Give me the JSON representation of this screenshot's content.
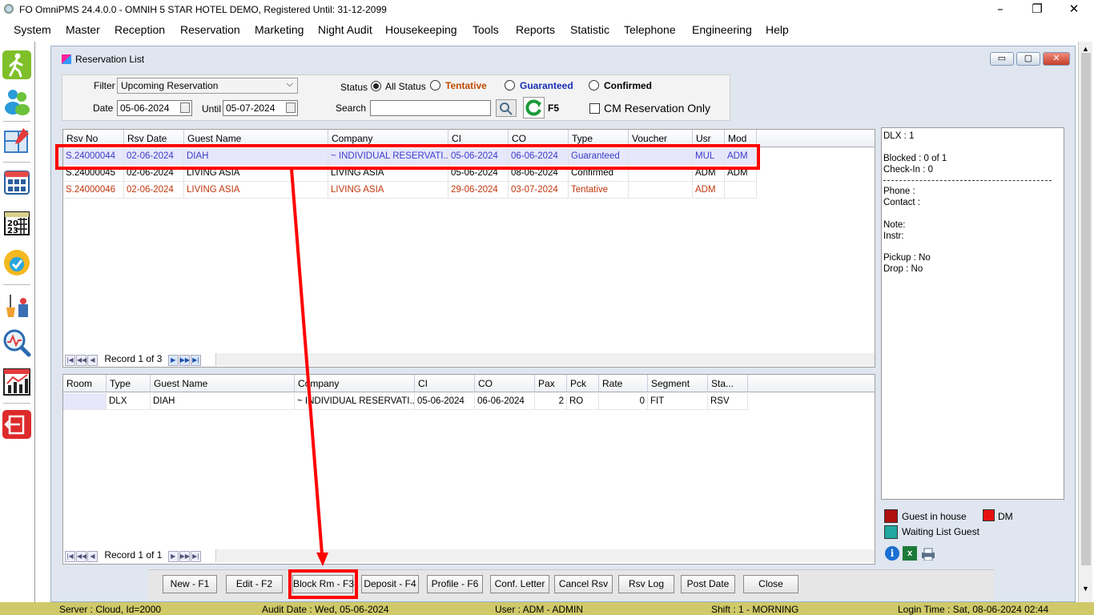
{
  "app": {
    "title": "FO OmniPMS 24.4.0.0 - OMNIH 5 STAR HOTEL DEMO, Registered Until: 31-12-2099",
    "minimize": "–",
    "restore": "❐",
    "close": "✕"
  },
  "menu": [
    "System",
    "Master",
    "Reception",
    "Reservation",
    "Marketing",
    "Night Audit",
    "Housekeeping",
    "Tools",
    "Reports",
    "Statistic",
    "Telephone",
    "Engineering",
    "Help"
  ],
  "sidebar_icons": [
    "walk-in-icon",
    "guests-icon",
    "room-plan-icon",
    "calendar-grid-icon",
    "calendar-2023-icon",
    "availability-icon",
    "housekeeping-icon",
    "search-analysis-icon",
    "statistics-chart-icon",
    "exit-icon"
  ],
  "window": {
    "title": "Reservation List",
    "ctl_min": "▭",
    "ctl_max": "▢",
    "ctl_close": "✕"
  },
  "filter": {
    "filter_label": "Filter",
    "filter_value": "Upcoming Reservation",
    "date_label": "Date",
    "date_value": "05-06-2024",
    "until_label": "Until",
    "until_value": "05-07-2024",
    "status_label": "Status",
    "status_options": [
      "All Status",
      "Tentative",
      "Guaranteed",
      "Confirmed"
    ],
    "status_selected": "All Status",
    "search_label": "Search",
    "search_value": "",
    "refresh_key": "F5",
    "cm_only_label": "CM Reservation Only"
  },
  "reservations": {
    "columns": [
      "Rsv No",
      "Rsv Date",
      "Guest Name",
      "Company",
      "CI",
      "CO",
      "Type",
      "Voucher",
      "Usr",
      "Mod"
    ],
    "rows": [
      [
        "S.24000044",
        "02-06-2024",
        "DIAH",
        "~ INDIVIDUAL RESERVATI...",
        "05-06-2024",
        "06-06-2024",
        "Guaranteed",
        "",
        "MUL",
        "ADM"
      ],
      [
        "S.24000045",
        "02-06-2024",
        "LIVING ASIA",
        "LIVING ASIA",
        "05-06-2024",
        "08-06-2024",
        "Confirmed",
        "",
        "ADM",
        "ADM"
      ],
      [
        "S.24000046",
        "02-06-2024",
        "LIVING ASIA",
        "LIVING ASIA",
        "29-06-2024",
        "03-07-2024",
        "Tentative",
        "",
        "ADM",
        ""
      ]
    ],
    "record_text": "Record 1 of 3"
  },
  "rooms": {
    "columns": [
      "Room",
      "Type",
      "Guest Name",
      "Company",
      "CI",
      "CO",
      "Pax",
      "Pck",
      "Rate",
      "Segment",
      "Sta..."
    ],
    "rows": [
      [
        "",
        "DLX",
        "DIAH",
        "~ INDIVIDUAL RESERVATI...",
        "05-06-2024",
        "06-06-2024",
        "2",
        "RO",
        "0",
        "FIT",
        "RSV"
      ]
    ],
    "record_text": "Record 1 of 1"
  },
  "info": {
    "room_type": "DLX : 1",
    "blocked": "Blocked : 0 of 1",
    "checkin": "Check-In : 0",
    "phone": "Phone :",
    "contact": "Contact :",
    "note": "Note:",
    "instr": "Instr:",
    "pickup": "Pickup : No",
    "drop": "Drop : No"
  },
  "legend": {
    "in_house": "Guest in house",
    "dm": "DM",
    "waiting": "Waiting List Guest",
    "colors": {
      "in_house": "#b01010",
      "dm": "#e81010",
      "waiting": "#20a8a0"
    }
  },
  "buttons": [
    "New - F1",
    "Edit - F2",
    "Block Rm - F3",
    "Deposit - F4",
    "Profile  - F6",
    "Conf. Letter",
    "Cancel Rsv",
    "Rsv Log",
    "Post Date",
    "Close"
  ],
  "status": {
    "server": "Server : Cloud, Id=2000",
    "audit": "Audit Date : Wed, 05-06-2024",
    "user": "User : ADM - ADMIN",
    "shift": "Shift : 1 - MORNING",
    "login": "Login Time : Sat, 08-06-2024 02:44"
  },
  "colors": {
    "status_bar": "#cfc96a",
    "highlight": "#ff0000",
    "selected_row_text": "#3c3cc8",
    "tentative_row_text": "#c0360c",
    "tentative_label": "#c04a00",
    "guaranteed_label": "#1a2fb4"
  }
}
